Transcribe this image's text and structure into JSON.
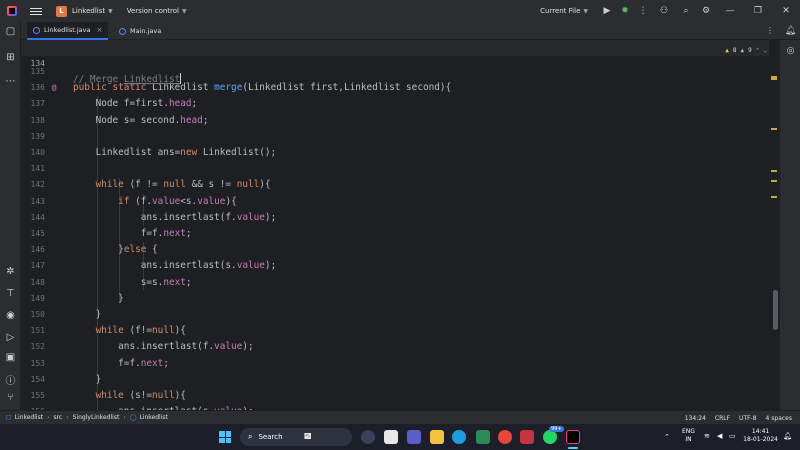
{
  "titlebar": {
    "project_badge": "L",
    "project_name": "Linkedlist",
    "vcs_label": "Version control",
    "run_config": "Current File",
    "icons": [
      "hamburger-menu-icon",
      "run-icon",
      "debug-icon",
      "more-icon",
      "code-with-me-icon",
      "search-icon",
      "settings-icon",
      "minimize-icon",
      "restore-icon",
      "close-icon"
    ]
  },
  "tabs": [
    {
      "label": "Linkedlist.java",
      "active": true
    },
    {
      "label": "Main.java",
      "active": false
    }
  ],
  "inspections": {
    "warnings": "8",
    "weak_warnings": "9"
  },
  "editor": {
    "sticky_line": {
      "number": "134",
      "text": "// Merge Linkedlist"
    },
    "lines": [
      {
        "n": "135",
        "tokens": []
      },
      {
        "n": "136",
        "gutter": "@",
        "tokens": [
          [
            "kw",
            "public static "
          ],
          [
            "p",
            "Linkedlist "
          ],
          [
            "fn",
            "merge"
          ],
          [
            "p",
            "(Linkedlist first,Linkedlist second){"
          ]
        ]
      },
      {
        "n": "137",
        "tokens": [
          [
            "p",
            "    Node f=first."
          ],
          [
            "fld",
            "head"
          ],
          [
            "p",
            ";"
          ]
        ]
      },
      {
        "n": "138",
        "tokens": [
          [
            "p",
            "    Node s= second."
          ],
          [
            "fld",
            "head"
          ],
          [
            "p",
            ";"
          ]
        ]
      },
      {
        "n": "139",
        "tokens": []
      },
      {
        "n": "140",
        "tokens": [
          [
            "p",
            "    Linkedlist ans="
          ],
          [
            "kw",
            "new "
          ],
          [
            "p",
            "Linkedlist();"
          ]
        ]
      },
      {
        "n": "141",
        "tokens": []
      },
      {
        "n": "142",
        "tokens": [
          [
            "kw",
            "    while "
          ],
          [
            "p",
            "(f != "
          ],
          [
            "kw",
            "null "
          ],
          [
            "p",
            "&& s != "
          ],
          [
            "kw",
            "null"
          ],
          [
            "p",
            "){"
          ]
        ]
      },
      {
        "n": "143",
        "tokens": [
          [
            "kw",
            "        if "
          ],
          [
            "p",
            "(f."
          ],
          [
            "fld",
            "value"
          ],
          [
            "p",
            "<s."
          ],
          [
            "fld",
            "value"
          ],
          [
            "p",
            "){"
          ]
        ]
      },
      {
        "n": "144",
        "tokens": [
          [
            "p",
            "            ans.insertlast(f."
          ],
          [
            "fld",
            "value"
          ],
          [
            "p",
            ");"
          ]
        ]
      },
      {
        "n": "145",
        "tokens": [
          [
            "p",
            "            f=f."
          ],
          [
            "fld",
            "next"
          ],
          [
            "p",
            ";"
          ]
        ]
      },
      {
        "n": "146",
        "tokens": [
          [
            "p",
            "        }"
          ],
          [
            "kw",
            "else "
          ],
          [
            "p",
            "{"
          ]
        ]
      },
      {
        "n": "147",
        "tokens": [
          [
            "p",
            "            ans.insertlast(s."
          ],
          [
            "fld",
            "value"
          ],
          [
            "p",
            ");"
          ]
        ]
      },
      {
        "n": "148",
        "tokens": [
          [
            "p",
            "            s=s."
          ],
          [
            "fld",
            "next"
          ],
          [
            "p",
            ";"
          ]
        ]
      },
      {
        "n": "149",
        "tokens": [
          [
            "p",
            "        }"
          ]
        ]
      },
      {
        "n": "150",
        "tokens": [
          [
            "p",
            "    }"
          ]
        ]
      },
      {
        "n": "151",
        "tokens": [
          [
            "kw",
            "    while "
          ],
          [
            "p",
            "(f!="
          ],
          [
            "kw",
            "null"
          ],
          [
            "p",
            "){"
          ]
        ]
      },
      {
        "n": "152",
        "tokens": [
          [
            "p",
            "        ans.insertlast(f."
          ],
          [
            "fld",
            "value"
          ],
          [
            "p",
            ");"
          ]
        ]
      },
      {
        "n": "153",
        "tokens": [
          [
            "p",
            "        f=f."
          ],
          [
            "fld",
            "next"
          ],
          [
            "p",
            ";"
          ]
        ]
      },
      {
        "n": "154",
        "tokens": [
          [
            "p",
            "    }"
          ]
        ]
      },
      {
        "n": "155",
        "tokens": [
          [
            "kw",
            "    while "
          ],
          [
            "p",
            "(s!="
          ],
          [
            "kw",
            "null"
          ],
          [
            "p",
            "){"
          ]
        ]
      },
      {
        "n": "156",
        "tokens": [
          [
            "p",
            "        ans.insertlast(s."
          ],
          [
            "fld",
            "value"
          ],
          [
            "p",
            ");"
          ]
        ]
      }
    ]
  },
  "statusbar": {
    "breadcrumbs": [
      "Linkedlist",
      "src",
      "SinglyLinkedlist",
      "Linkedlist"
    ],
    "caret_position": "134:24",
    "line_separator": "CRLF",
    "encoding": "UTF-8",
    "indent": "4 spaces"
  },
  "taskbar": {
    "search_label": "Search",
    "lang_line1": "ENG",
    "lang_line2": "IN",
    "time": "14:41",
    "date": "18-01-2024",
    "badge": "99+"
  },
  "colors": {
    "keyword": "#cf8e6d",
    "function": "#56a8f5",
    "field": "#c77dbb",
    "comment": "#7a7e85",
    "accent": "#3574f0"
  }
}
